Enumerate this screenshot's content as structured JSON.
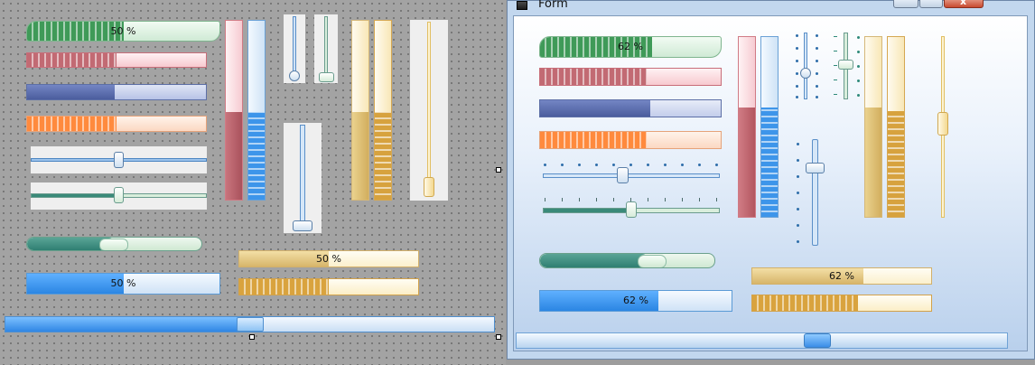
{
  "window": {
    "title": "Form",
    "app_icon": "form-window-icon",
    "buttons": [
      "minimize-icon",
      "maximize-icon",
      "close-icon"
    ]
  },
  "designer": {
    "green_round_progress": {
      "value_percent": 50,
      "label": "50 %"
    },
    "red_progress": {
      "value_percent": 50
    },
    "dark_blue_progress": {
      "value_percent": 50
    },
    "orange_progress": {
      "value_percent": 50
    },
    "blue_slider": {
      "value_percent": 50
    },
    "green_slider": {
      "value_percent": 50
    },
    "teal_round_progress": {
      "value_percent": 50
    },
    "blue_progress": {
      "value_percent": 50,
      "label": "50 %"
    },
    "tan_progress": {
      "value_percent": 50,
      "label": "50 %"
    },
    "gold_segmented_progress": {
      "value_percent": 50
    },
    "red_vertical_progress": {
      "value_percent": 50
    },
    "blue_vertical_progress": {
      "value_percent": 50
    },
    "tan_vertical_progress": {
      "value_percent": 50
    },
    "gold_vertical_progress": {
      "value_percent": 50
    },
    "vertical_slider_1": {
      "value_percent": 0
    },
    "vertical_slider_2": {
      "value_percent": 0
    },
    "vertical_slider_3": {
      "value_percent": 0
    },
    "vertical_slider_4": {
      "value_percent": 0
    },
    "bottom_scrollbar": {
      "value_percent": 50
    }
  },
  "form": {
    "green_round_progress": {
      "value_percent": 62,
      "label": "62 %"
    },
    "red_progress": {
      "value_percent": 62
    },
    "dark_blue_progress": {
      "value_percent": 62
    },
    "orange_progress": {
      "value_percent": 62
    },
    "blue_slider": {
      "value_percent": 45
    },
    "green_slider": {
      "value_percent": 50
    },
    "teal_round_progress": {
      "value_percent": 62
    },
    "blue_progress": {
      "value_percent": 62,
      "label": "62 %"
    },
    "tan_progress": {
      "value_percent": 62,
      "label": "62 %"
    },
    "gold_segmented_progress": {
      "value_percent": 62
    },
    "red_vertical_progress": {
      "value_percent": 62
    },
    "blue_vertical_progress": {
      "value_percent": 62
    },
    "tan_vertical_progress": {
      "value_percent": 62
    },
    "gold_vertical_progress": {
      "value_percent": 62
    },
    "bottom_scrollbar": {
      "value_percent": 60
    }
  }
}
